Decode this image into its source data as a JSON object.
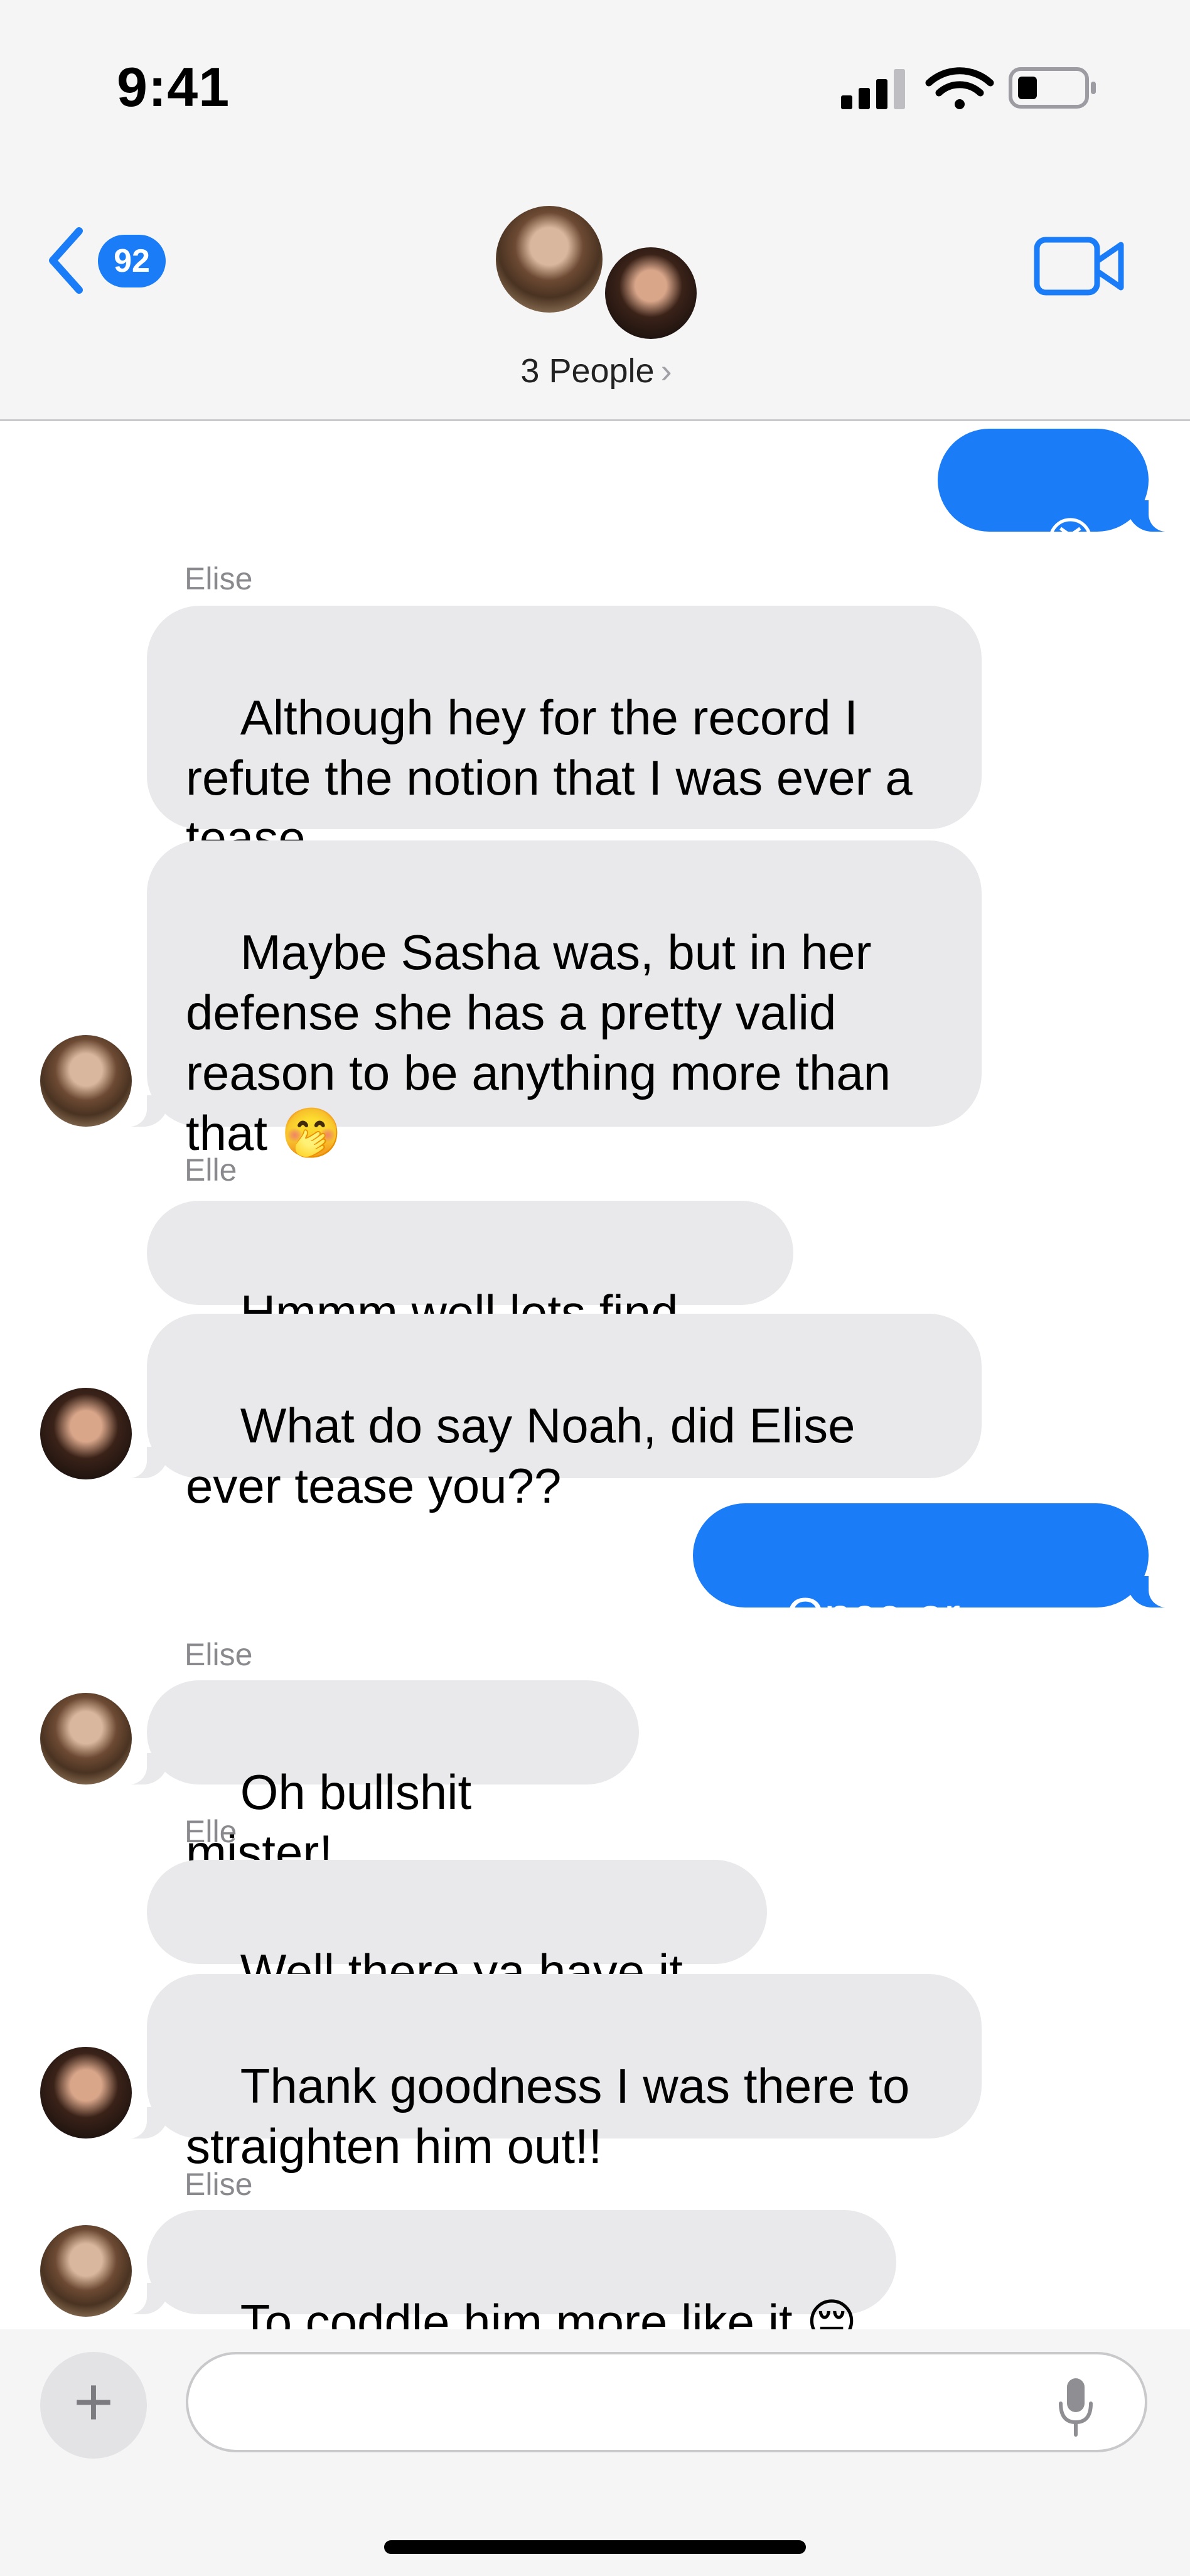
{
  "status_bar": {
    "time": "9:41",
    "icons": [
      "signal-icon",
      "wifi-icon",
      "battery-icon"
    ]
  },
  "header": {
    "back_count": "92",
    "group_label": "3 People",
    "chevron": "›",
    "icons": [
      "back-chevron-icon",
      "video-call-icon"
    ]
  },
  "messages": [
    {
      "direction": "out",
      "text": "😫😫"
    },
    {
      "sender_label": "Elise"
    },
    {
      "direction": "in",
      "sender": "Elise",
      "text": "Although hey for the record I refute the notion that I was ever a tease"
    },
    {
      "direction": "in",
      "sender": "Elise",
      "text": "Maybe Sasha was, but in her defense she has a pretty valid reason to be anything more than that 🤭"
    },
    {
      "sender_label": "Elle"
    },
    {
      "direction": "in",
      "sender": "Elle",
      "text": "Hmmm well lets find out!"
    },
    {
      "direction": "in",
      "sender": "Elle",
      "text": "What do say Noah, did Elise ever tease you??"
    },
    {
      "direction": "out",
      "text": "Once or twice...."
    },
    {
      "sender_label": "Elise"
    },
    {
      "direction": "in",
      "sender": "Elise",
      "text": "Oh bullshit mister!"
    },
    {
      "sender_label": "Elle"
    },
    {
      "direction": "in",
      "sender": "Elle",
      "text": "Well there ya have it 🤷‍♀️"
    },
    {
      "direction": "in",
      "sender": "Elle",
      "text": "Thank goodness I was there to straighten him out!!"
    },
    {
      "sender_label": "Elise"
    },
    {
      "direction": "in",
      "sender": "Elise",
      "text": "To coddle him more like it 😔"
    }
  ],
  "compose": {
    "plus": "+",
    "input_value": "",
    "icons": [
      "plus-icon",
      "microphone-icon"
    ]
  },
  "colors": {
    "accent_blue": "#1a7cf6",
    "incoming_bubble": "#e9e9eb",
    "header_bg": "#f5f5f6",
    "sender_gray": "#8a8a8e"
  }
}
